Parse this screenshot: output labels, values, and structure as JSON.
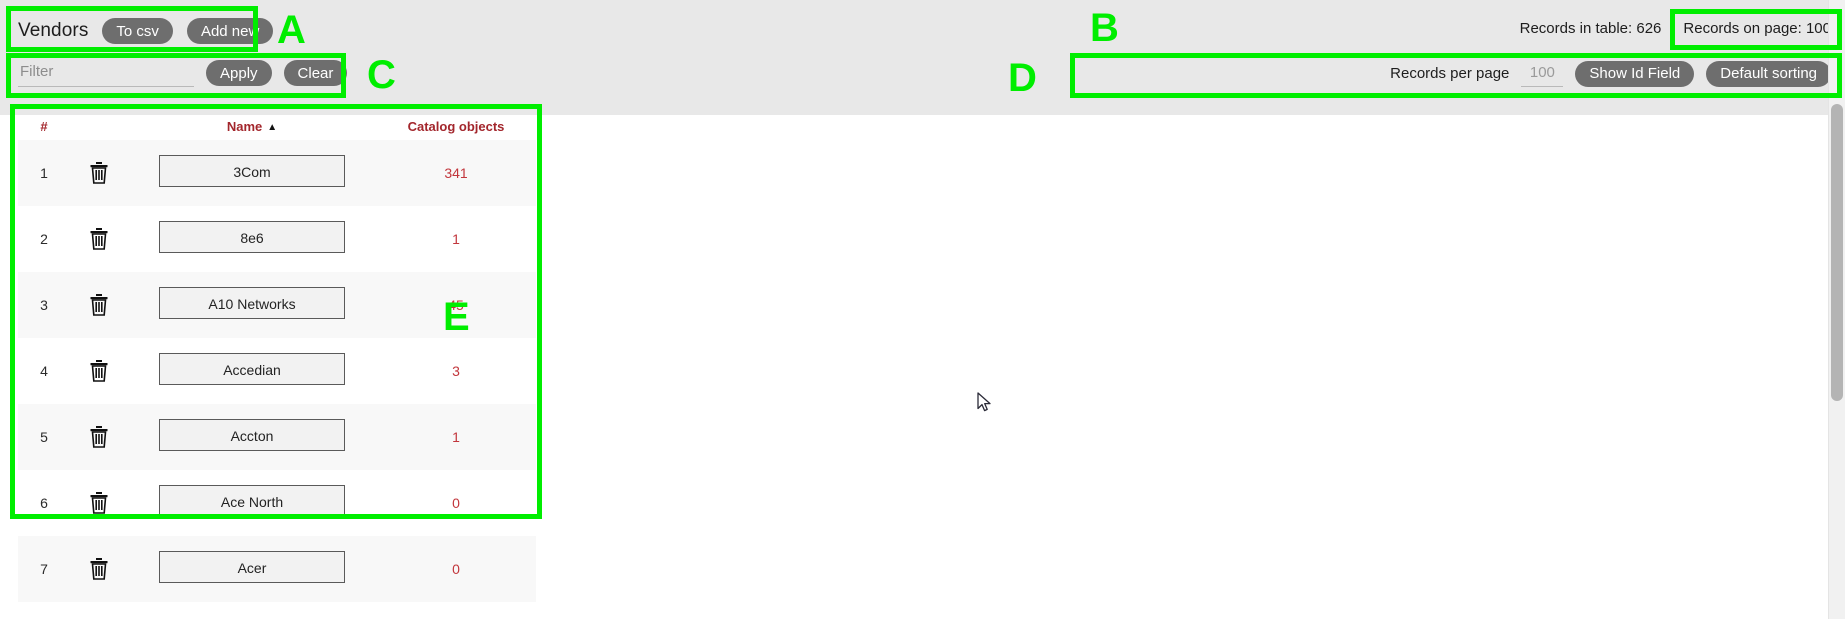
{
  "header": {
    "title": "Vendors",
    "to_csv_label": "To csv",
    "add_new_label": "Add new"
  },
  "filter": {
    "placeholder": "Filter",
    "value": "",
    "apply_label": "Apply",
    "clear_label": "Clear"
  },
  "counts": {
    "records_in_table": "Records in table: 626",
    "records_on_page": "Records on page: 100"
  },
  "perpage": {
    "label": "Records per page",
    "value": "",
    "placeholder": "100",
    "show_id_field_label": "Show Id Field",
    "default_sorting_label": "Default sorting"
  },
  "table": {
    "columns": {
      "index": "#",
      "delete": "",
      "name": "Name",
      "catalog_objects": "Catalog objects"
    },
    "sort_caret": "▲",
    "rows": [
      {
        "index": "1",
        "name": "3Com",
        "catalog_objects": "341"
      },
      {
        "index": "2",
        "name": "8e6",
        "catalog_objects": "1"
      },
      {
        "index": "3",
        "name": "A10 Networks",
        "catalog_objects": "45"
      },
      {
        "index": "4",
        "name": "Accedian",
        "catalog_objects": "3"
      },
      {
        "index": "5",
        "name": "Accton",
        "catalog_objects": "1"
      },
      {
        "index": "6",
        "name": "Ace North",
        "catalog_objects": "0"
      },
      {
        "index": "7",
        "name": "Acer",
        "catalog_objects": "0"
      }
    ]
  },
  "annotations": {
    "a": "A",
    "b": "B",
    "c": "C",
    "d": "D",
    "e": "E"
  },
  "colors": {
    "annotation": "#00ee00",
    "header_text": "#a3262c",
    "catalog_value": "#c2363c",
    "pill_bg": "#6e6e6e",
    "band_bg": "#e8e8e8"
  }
}
